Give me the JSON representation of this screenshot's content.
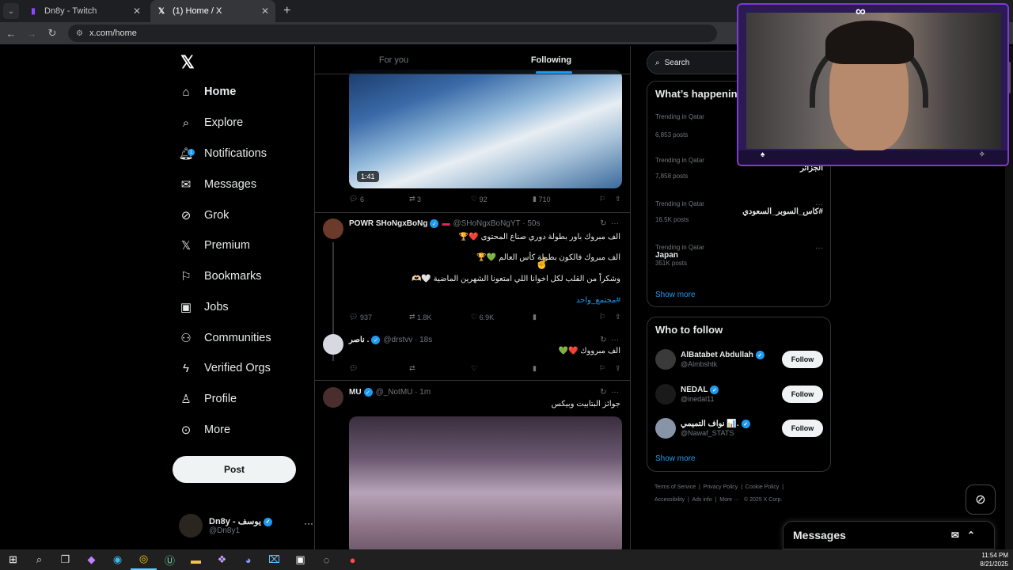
{
  "browser": {
    "tabs": [
      {
        "title": "Dn8y - Twitch",
        "icon": "twitch-icon",
        "active": false
      },
      {
        "title": "(1) Home / X",
        "icon": "x-logo-icon",
        "active": true
      }
    ],
    "url": "x.com/home"
  },
  "sidebar": {
    "items": [
      {
        "label": "Home",
        "icon": "home-icon"
      },
      {
        "label": "Explore",
        "icon": "search-icon"
      },
      {
        "label": "Notifications",
        "icon": "bell-icon",
        "badge": "1"
      },
      {
        "label": "Messages",
        "icon": "mail-icon"
      },
      {
        "label": "Grok",
        "icon": "grok-icon"
      },
      {
        "label": "Premium",
        "icon": "x-logo-icon"
      },
      {
        "label": "Bookmarks",
        "icon": "bookmark-icon"
      },
      {
        "label": "Jobs",
        "icon": "briefcase-icon"
      },
      {
        "label": "Communities",
        "icon": "people-icon"
      },
      {
        "label": "Verified Orgs",
        "icon": "lightning-icon"
      },
      {
        "label": "Profile",
        "icon": "person-icon"
      },
      {
        "label": "More",
        "icon": "more-circle-icon"
      }
    ],
    "post_label": "Post",
    "account": {
      "name": "Dn8y - يوسف",
      "handle": "@Dn8y1"
    }
  },
  "feed": {
    "tabs": [
      "For you",
      "Following"
    ],
    "tweet1": {
      "duration": "1:41",
      "replies": "6",
      "reposts": "3",
      "likes": "92",
      "views": "710"
    },
    "tweet2": {
      "name": "POWR SHoNgxBoNg",
      "handle": "@SHoNgxBoNgYT · 50s",
      "lines": [
        "الف مبروك باور بطولة دوري صناع المحتوى ❤️🏆",
        "الف مبروك فالكون بطولة كأس العالم 💚🏆",
        "وشكراً من القلب لكل اخوانا اللي امتعونا الشهرين الماضية 🤍🫶🏻"
      ],
      "hashtag": "#مجتمع_واحد",
      "replies": "937",
      "reposts": "1.8K",
      "likes": "6.9K"
    },
    "tweet3": {
      "name": "ناصر .",
      "handle": "@drstvv · 18s",
      "text": "الف مبرووك ❤️💚"
    },
    "tweet4": {
      "name": "MU",
      "handle": "@_NotMU · 1m",
      "text": "جوائز البتابيت وبيكس"
    }
  },
  "right": {
    "search_placeholder": "Search",
    "trends_title": "What’s happening",
    "trends": [
      {
        "meta": "Trending in Qatar",
        "topic": "",
        "count": "6,853 posts"
      },
      {
        "meta": "Trending in Qatar",
        "topic": "الجزائر",
        "count": "7,858 posts"
      },
      {
        "meta": "Trending in Qatar",
        "topic": "#كاس_السوبر_السعودي",
        "count": "16.5K posts"
      },
      {
        "meta": "Trending in Qatar",
        "topic": "Japan",
        "count": "351K posts"
      }
    ],
    "show_more": "Show more",
    "wtf_title": "Who to follow",
    "follow_label": "Follow",
    "wtf": [
      {
        "name": "AlBatabet Abdullah",
        "handle": "@Almbshtk"
      },
      {
        "name": "NEDAL",
        "handle": "@inedal11"
      },
      {
        "name": "نواف التميمي 📊.",
        "handle": "@Nawaf_STATS"
      }
    ],
    "footer": [
      "Terms of Service",
      "Privacy Policy",
      "Cookie Policy",
      "Accessibility",
      "Ads info",
      "More ···",
      "© 2025 X Corp."
    ],
    "messages_label": "Messages"
  },
  "taskbar": {
    "time": "11:54 PM",
    "date": "8/21/2025"
  },
  "colors": {
    "accent": "#1d9bf0",
    "stream_frame": "#7c3bd6"
  }
}
